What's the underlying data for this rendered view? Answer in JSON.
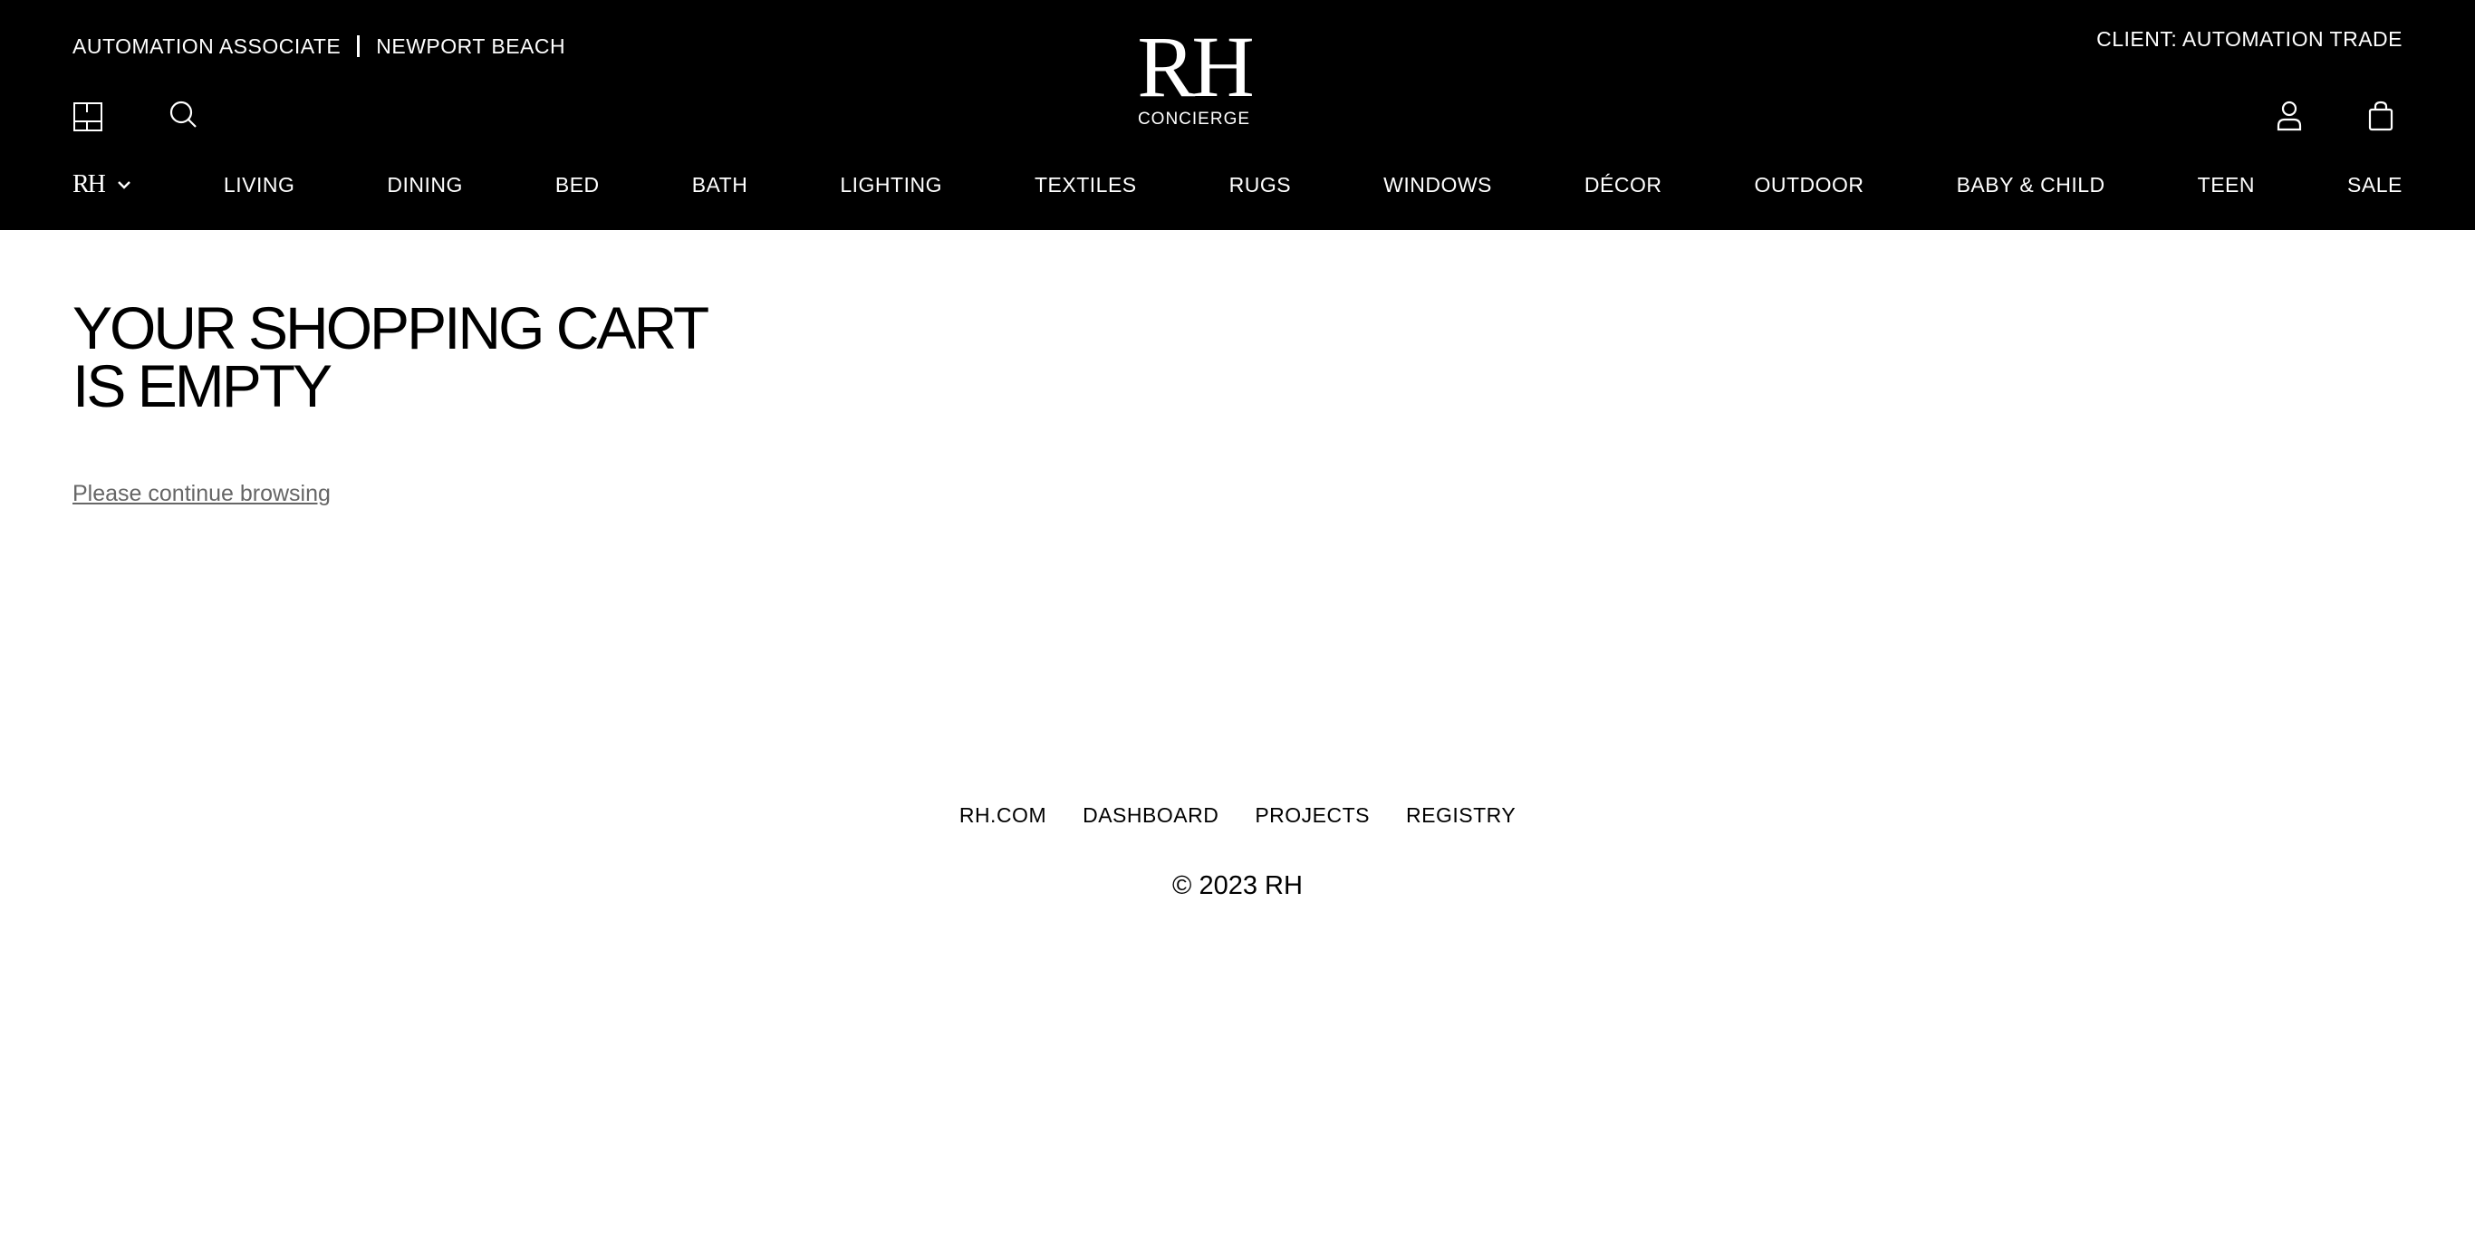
{
  "header": {
    "associate_name": "AUTOMATION ASSOCIATE",
    "location": "NEWPORT BEACH",
    "client_label": "CLIENT: AUTOMATION TRADE",
    "logo_text": "RH",
    "logo_subtitle": "CONCIERGE",
    "brand_switcher_text": "RH",
    "icons": {
      "floorplan": "floorplan-icon",
      "search": "search-icon",
      "account": "account-icon",
      "cart": "shopping-bag-icon",
      "chevron": "chevron-down-icon"
    }
  },
  "nav": {
    "items": [
      {
        "label": "LIVING"
      },
      {
        "label": "DINING"
      },
      {
        "label": "BED"
      },
      {
        "label": "BATH"
      },
      {
        "label": "LIGHTING"
      },
      {
        "label": "TEXTILES"
      },
      {
        "label": "RUGS"
      },
      {
        "label": "WINDOWS"
      },
      {
        "label": "DÉCOR"
      },
      {
        "label": "OUTDOOR"
      },
      {
        "label": "BABY & CHILD"
      },
      {
        "label": "TEEN"
      },
      {
        "label": "SALE"
      }
    ]
  },
  "main": {
    "title": "YOUR SHOPPING CART IS EMPTY",
    "continue_link": "Please continue browsing"
  },
  "footer": {
    "links": [
      {
        "label": "RH.COM"
      },
      {
        "label": "DASHBOARD"
      },
      {
        "label": "PROJECTS"
      },
      {
        "label": "REGISTRY"
      }
    ],
    "copyright": "© 2023 RH"
  },
  "colors": {
    "header_bg": "#000000",
    "header_text": "#ffffff",
    "page_bg": "#ffffff",
    "link_gray": "#666666"
  }
}
